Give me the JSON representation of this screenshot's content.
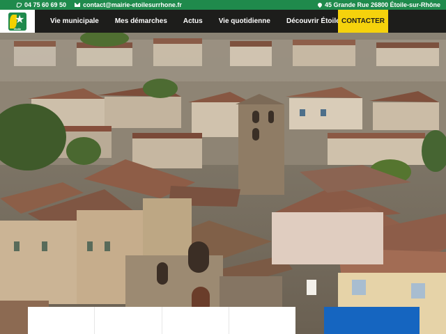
{
  "topbar": {
    "phone": "04 75 60 69 50",
    "email": "contact@mairie-etoilesurrhone.fr",
    "address": "45 Grande Rue 26800 Étoile-sur-Rhône",
    "icons": {
      "phone": "phone-icon",
      "email": "mail-icon",
      "address": "map-pin-icon"
    }
  },
  "nav": {
    "logo_text": "étoile",
    "items": [
      {
        "label": "Vie municipale"
      },
      {
        "label": "Mes démarches"
      },
      {
        "label": "Actus"
      },
      {
        "label": "Vie quotidienne"
      },
      {
        "label": "Découvrir Étoile"
      }
    ],
    "cta_label": "CONTACTER"
  },
  "colors": {
    "topbar": "#1f8a4c",
    "navbar": "#1d1d1b",
    "cta": "#f5d20c",
    "panel_blue": "#1565c0"
  }
}
